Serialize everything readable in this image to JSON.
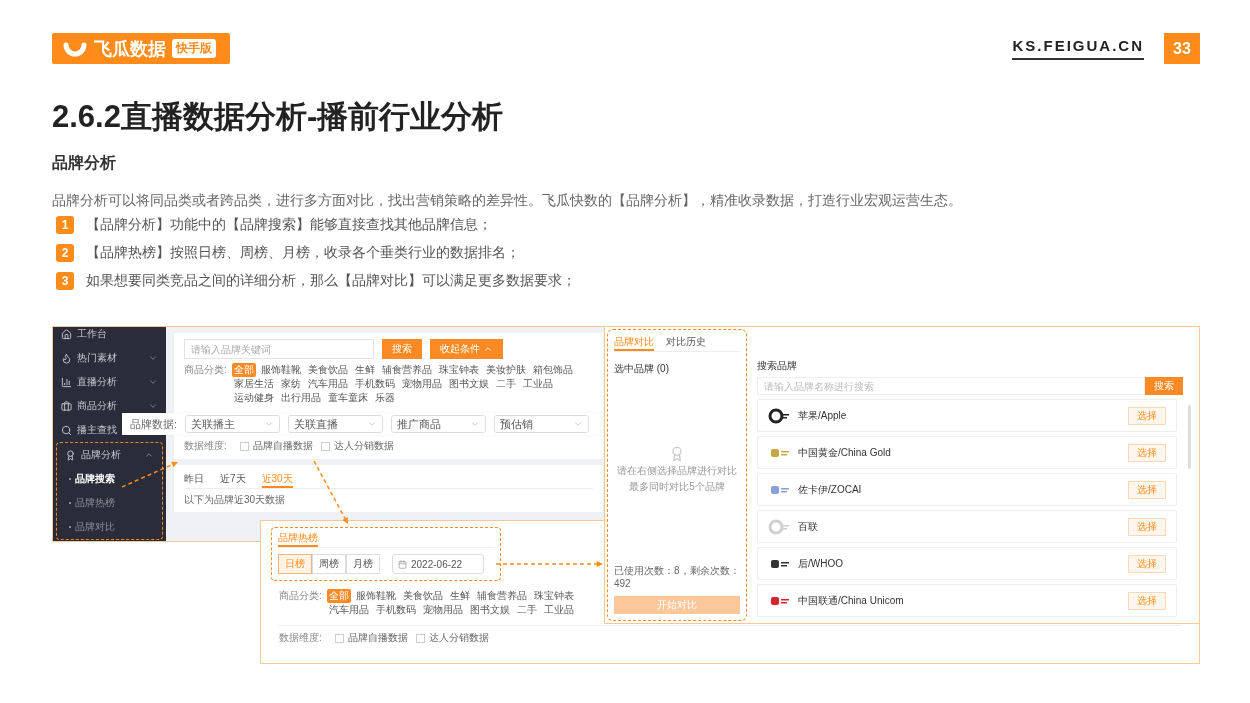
{
  "header": {
    "logo_text": "飞瓜数据",
    "logo_badge": "快手版",
    "site": "KS.FEIGUA.CN",
    "page": "33"
  },
  "title": "2.6.2直播数据分析-播前行业分析",
  "subtitle": "品牌分析",
  "intro": "品牌分析可以将同品类或者跨品类，进行多方面对比，找出营销策略的差异性。飞瓜快数的【品牌分析】，精准收录数据，打造行业宏观运营生态。",
  "points": [
    {
      "number": "1",
      "text": "【品牌分析】功能中的【品牌搜索】能够直接查找其他品牌信息；"
    },
    {
      "number": "2",
      "text": "【品牌热榜】按照日榜、周榜、月榜，收录各个垂类行业的数据排名；"
    },
    {
      "number": "3",
      "text": "如果想要同类竞品之间的详细分析，那么【品牌对比】可以满足更多数据要求；"
    }
  ],
  "search_screen": {
    "sidebar": [
      {
        "label": "工作台"
      },
      {
        "label": "热门素材",
        "expanded": false
      },
      {
        "label": "直播分析",
        "expanded": false
      },
      {
        "label": "商品分析",
        "expanded": false
      },
      {
        "label": "播主查找"
      },
      {
        "label": "品牌分析",
        "expanded": true,
        "children": [
          {
            "label": "品牌搜索",
            "selected": true
          },
          {
            "label": "品牌热榜",
            "selected": false
          },
          {
            "label": "品牌对比",
            "selected": false
          }
        ]
      }
    ],
    "search": {
      "placeholder": "请输入品牌关键词",
      "button": "搜索",
      "toggle": "收起条件"
    },
    "categories": {
      "label": "商品分类:",
      "items": [
        {
          "label": "全部",
          "selected": true
        },
        {
          "label": "服饰鞋靴",
          "selected": false
        },
        {
          "label": "美食饮品",
          "selected": false
        },
        {
          "label": "生鲜",
          "selected": false
        },
        {
          "label": "辅食营养品",
          "selected": false
        },
        {
          "label": "珠宝钟表",
          "selected": false
        },
        {
          "label": "美妆护肤",
          "selected": false
        },
        {
          "label": "箱包饰品",
          "selected": false
        },
        {
          "label": "家居生活",
          "selected": false
        },
        {
          "label": "家纺",
          "selected": false
        },
        {
          "label": "汽车用品",
          "selected": false
        },
        {
          "label": "手机数码",
          "selected": false
        },
        {
          "label": "宠物用品",
          "selected": false
        },
        {
          "label": "图书文娱",
          "selected": false
        },
        {
          "label": "二手",
          "selected": false
        },
        {
          "label": "工业品",
          "selected": false
        },
        {
          "label": "运动健身",
          "selected": false
        },
        {
          "label": "出行用品",
          "selected": false
        },
        {
          "label": "童车童床",
          "selected": false
        },
        {
          "label": "乐器",
          "selected": false
        }
      ]
    },
    "brand_data": {
      "label": "品牌数据:",
      "selects": [
        "关联播主",
        "关联直播",
        "推广商品",
        "预估销"
      ]
    },
    "dimension": {
      "label": "数据维度:",
      "options": [
        {
          "label": "品牌自播数据",
          "checked": false
        },
        {
          "label": "达人分销数据",
          "checked": false
        }
      ]
    },
    "ranges": [
      {
        "label": "昨日",
        "selected": false
      },
      {
        "label": "近7天",
        "selected": false
      },
      {
        "label": "近30天",
        "selected": true
      }
    ],
    "note": "以下为品牌近30天数据"
  },
  "hot_list_screen": {
    "tabs": [
      {
        "label": "品牌热榜",
        "selected": true
      }
    ],
    "periods": [
      {
        "label": "日榜",
        "selected": true
      },
      {
        "label": "周榜",
        "selected": false
      },
      {
        "label": "月榜",
        "selected": false
      }
    ],
    "date": "2022-06-22",
    "categories": {
      "label": "商品分类:",
      "items": [
        {
          "label": "全部",
          "selected": true
        },
        {
          "label": "服饰鞋靴",
          "selected": false
        },
        {
          "label": "美食饮品",
          "selected": false
        },
        {
          "label": "生鲜",
          "selected": false
        },
        {
          "label": "辅食营养品",
          "selected": false
        },
        {
          "label": "珠宝钟表",
          "selected": false
        },
        {
          "label": "汽车用品",
          "selected": false
        },
        {
          "label": "手机数码",
          "selected": false
        },
        {
          "label": "宠物用品",
          "selected": false
        },
        {
          "label": "图书文娱",
          "selected": false
        },
        {
          "label": "二手",
          "selected": false
        },
        {
          "label": "工业品",
          "selected": false
        }
      ]
    },
    "dimension": {
      "label": "数据维度:",
      "options": [
        {
          "label": "品牌自播数据",
          "checked": false
        },
        {
          "label": "达人分销数据",
          "checked": false
        }
      ]
    }
  },
  "compare_screen": {
    "tabs": [
      {
        "label": "品牌对比",
        "selected": true
      },
      {
        "label": "对比历史",
        "selected": false
      }
    ],
    "selected_label": "选中品牌 (0)",
    "empty_hint": [
      "请在右侧选择品牌进行对比",
      "最多同时对比5个品牌"
    ],
    "usage": "已使用次数：8，剩余次数：492",
    "start_button": {
      "label": "开始对比",
      "disabled": true
    },
    "search_label": "搜索品牌",
    "search_placeholder": "请输入品牌名称进行搜索",
    "search_button": "搜索",
    "brands": [
      {
        "name": "苹果/Apple",
        "action": "选择"
      },
      {
        "name": "中国黄金/China Gold",
        "action": "选择"
      },
      {
        "name": "佐卡伊/ZOCAI",
        "action": "选择"
      },
      {
        "name": "百联",
        "action": "选择"
      },
      {
        "name": "后/WHOO",
        "action": "选择"
      },
      {
        "name": "中国联通/China Unicom",
        "action": "选择"
      }
    ]
  }
}
